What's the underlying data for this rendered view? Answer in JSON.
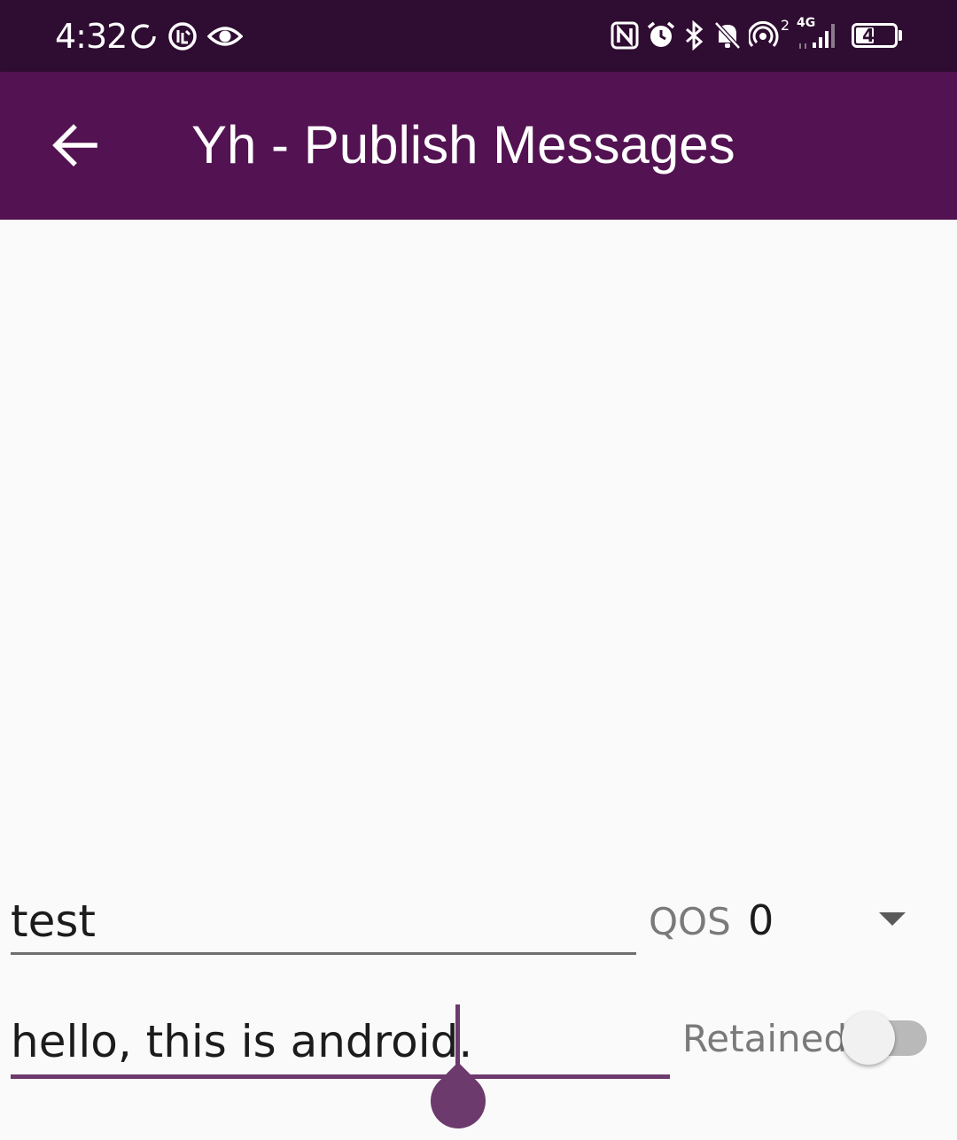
{
  "status_bar": {
    "time": "4:32",
    "left_icons": [
      "sync-icon",
      "data-saver-icon",
      "eye-icon"
    ],
    "right_icons": [
      "nfc-icon",
      "alarm-icon",
      "bluetooth-icon",
      "bell-off-icon",
      "hotspot-icon",
      "signal-icon"
    ],
    "hotspot_count": "2",
    "network_type": "4G",
    "battery_level": "47",
    "battery_fraction": 0.47
  },
  "app_bar": {
    "back_icon": "arrow-left-icon",
    "title": "Yh - Publish Messages",
    "background_color": "#531251"
  },
  "form": {
    "topic_value": "test",
    "qos_label": "QOS",
    "qos_value": "0",
    "message_value": "hello, this is android.",
    "retained_label": "Retained",
    "retained_on": false,
    "accent_color": "#6c3a6d"
  }
}
